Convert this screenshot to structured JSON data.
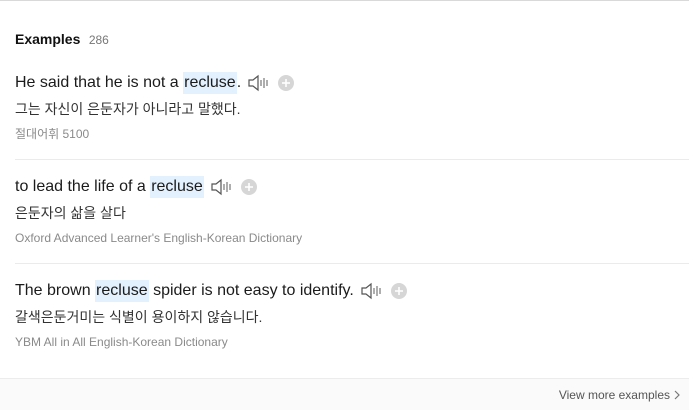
{
  "header": {
    "title": "Examples",
    "count": "286"
  },
  "examples": [
    {
      "before": "He said that he is not a ",
      "highlight": "recluse",
      "after": ".",
      "translation": "그는 자신이 은둔자가 아니라고 말했다.",
      "source": "절대어휘 5100"
    },
    {
      "before": "to lead the life of a ",
      "highlight": "recluse",
      "after": "",
      "translation": "은둔자의 삶을 살다",
      "source": "Oxford Advanced Learner's English-Korean Dictionary"
    },
    {
      "before": "The brown ",
      "highlight": "recluse",
      "after": " spider is not easy to identify.",
      "translation": "갈색은둔거미는 식별이 용이하지 않습니다.",
      "source": "YBM All in All English-Korean Dictionary"
    }
  ],
  "footer": {
    "more_label": "View more examples"
  },
  "icons": {
    "speaker": "speaker-icon",
    "add": "plus-circle-icon",
    "chevron": "chevron-right-icon"
  },
  "colors": {
    "highlight": "#e3f0fd",
    "source_text": "#8a8a8a"
  }
}
